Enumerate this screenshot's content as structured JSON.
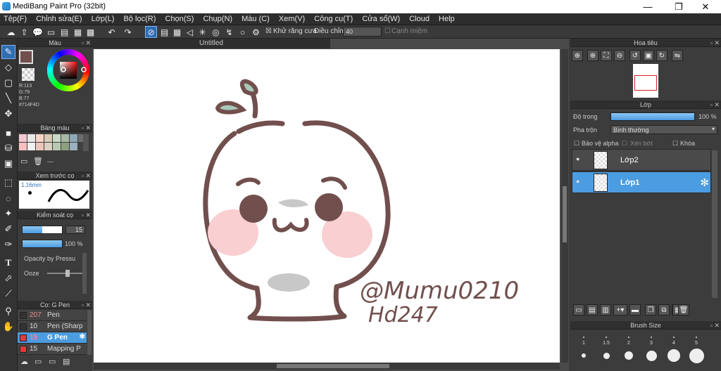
{
  "window": {
    "title": "MediBang Paint Pro (32bit)",
    "minimize": "—",
    "maximize": "❐",
    "close": "✕"
  },
  "menu": [
    "Tệp(F)",
    "Chỉnh sửa(E)",
    "Lớp(L)",
    "Bộ lọc(R)",
    "Chọn(S)",
    "Chụp(N)",
    "Màu (C)",
    "Xem(V)",
    "Công cụ(T)",
    "Cửa sổ(W)",
    "Cloud",
    "Help"
  ],
  "toolbar": {
    "antialias_label": "Khử răng cưa",
    "adjust_label": "Điều chỉnh",
    "adjust_value": "40",
    "edge_label": "Cạnh miệm"
  },
  "color_panel": {
    "title": "Màu",
    "r": "R:113",
    "g": "G:79",
    "b": "B:77",
    "hex": "#714F4D",
    "primary": "#714F4D"
  },
  "palette_panel": {
    "title": "Bảng màu",
    "swatches": [
      "#f2c9d0",
      "#e8e8e8",
      "#f5d5c8",
      "#d9c9b5",
      "#c9d9c5",
      "#a6b9a3",
      "#8fa8b6",
      "#6e6e6e",
      "#f7c0c0",
      "#f0f0f0",
      "#ecc6bc",
      "#dcd2c4",
      "#b7c9b3",
      "#8da07f",
      "#9bb0c0",
      "#404040"
    ],
    "more": "---"
  },
  "brush_preview": {
    "title": "Xem trước cọ",
    "size": "1.16mm"
  },
  "brush_control": {
    "title": "Kiểm soát cọ",
    "size_value": "15",
    "size_fraction": 0.5,
    "opacity_value": "100 %",
    "opacity_fraction": 1.0,
    "pressure_label": "Opacity by Pressu",
    "ooze_label": "Ooze"
  },
  "brush_list": {
    "title": "Cọ: G Pen",
    "items": [
      {
        "size": "207",
        "name": "Pen",
        "color": "#333333"
      },
      {
        "size": "10",
        "name": "Pen (Sharp",
        "color": "#333333"
      },
      {
        "size": "15",
        "name": "G Pen",
        "color": "#e03a3a",
        "selected": true
      },
      {
        "size": "15",
        "name": "Mapping P",
        "color": "#e03a3a"
      }
    ]
  },
  "canvas": {
    "tab_title": "Untitled",
    "signature_line1": "@Mumu0210",
    "signature_line2": "Hd247"
  },
  "navigator": {
    "title": "Hoa tiêu"
  },
  "layer_panel": {
    "title": "Lớp",
    "opacity_label": "Độ trong",
    "opacity_value": "100 %",
    "opacity_fraction": 1.0,
    "blend_label": "Pha trộn",
    "blend_value": "Bình thường",
    "protect_alpha": "Bảo vệ alpha",
    "clip": "Xén bớt",
    "lock": "Khóa",
    "layers": [
      {
        "name": "Lớp2",
        "selected": false
      },
      {
        "name": "Lớp1",
        "selected": true
      }
    ]
  },
  "brush_size_panel": {
    "title": "Brush Size",
    "labels": [
      "1",
      "1.5",
      "2",
      "3",
      "4",
      "5"
    ]
  },
  "colors": {
    "accent": "#4b9ce0",
    "stroke": "#714F4D",
    "blush": "#f9cfd2",
    "gray": "#c8c8c8",
    "leaf": "#a8c8b8"
  }
}
